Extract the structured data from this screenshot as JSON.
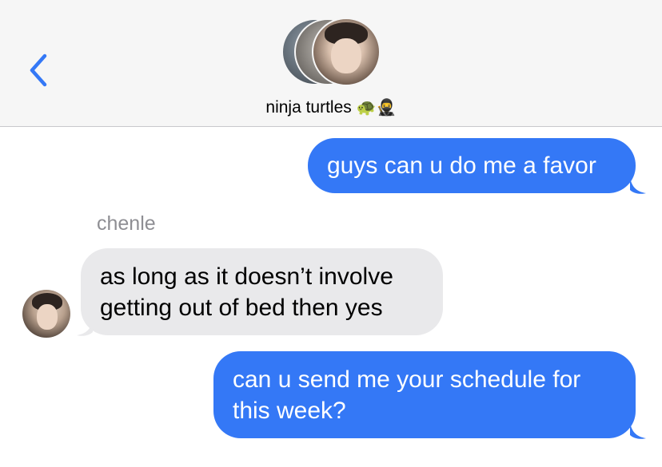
{
  "header": {
    "back_label": "<",
    "group_name": "ninja turtles",
    "group_emoji": "🐢🥷",
    "avatars": [
      "group-member-avatar-1",
      "group-member-avatar-2",
      "group-member-avatar-3"
    ]
  },
  "messages": [
    {
      "direction": "outgoing",
      "text": "guys can u do me a favor"
    },
    {
      "direction": "incoming",
      "sender": "chenle",
      "lines": [
        "as long as it doesn’t involve",
        "getting out of bed then yes"
      ]
    },
    {
      "direction": "outgoing",
      "lines": [
        "can u send me your schedule for",
        "this week?"
      ]
    }
  ],
  "colors": {
    "outgoing": "#3478f6",
    "incoming": "#e9e9eb",
    "accent": "#3478f6"
  }
}
